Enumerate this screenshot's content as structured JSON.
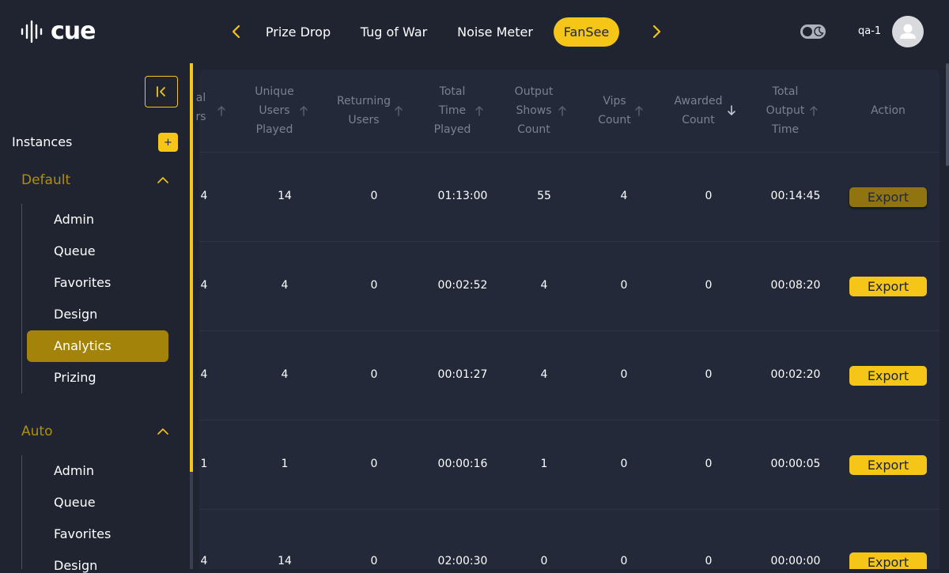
{
  "brand": {
    "logo_text": "cue"
  },
  "header": {
    "game_tabs": [
      "Prize Drop",
      "Tug of War",
      "Noise Meter",
      "FanSee"
    ],
    "active_tab": "FanSee",
    "username": "qa-1"
  },
  "colors": {
    "accent": "#f5c518",
    "background": "#1f2430",
    "active_item": "#a3830a"
  },
  "sidebar": {
    "instances_label": "Instances",
    "add_label": "+",
    "groups": [
      {
        "title": "Default",
        "items": [
          "Admin",
          "Queue",
          "Favorites",
          "Design",
          "Analytics",
          "Prizing"
        ],
        "active": "Analytics"
      },
      {
        "title": "Auto",
        "items": [
          "Admin",
          "Queue",
          "Favorites",
          "Design"
        ]
      }
    ]
  },
  "table": {
    "columns": [
      {
        "label": "Total Users",
        "visible_text": [
          "al",
          "rs"
        ]
      },
      {
        "label": "Unique Users Played",
        "lines": [
          "Unique",
          "Users",
          "Played"
        ]
      },
      {
        "label": "Returning Users",
        "lines": [
          "Returning",
          "Users"
        ]
      },
      {
        "label": "Total Time Played",
        "lines": [
          "Total",
          "Time",
          "Played"
        ]
      },
      {
        "label": "Output Shows Count",
        "lines": [
          "Output",
          "Shows",
          "Count"
        ]
      },
      {
        "label": "Vips Count",
        "lines": [
          "Vips",
          "Count"
        ]
      },
      {
        "label": "Awarded Count",
        "lines": [
          "Awarded",
          "Count"
        ]
      },
      {
        "label": "Total Output Time",
        "lines": [
          "Total",
          "Output",
          "Time"
        ]
      },
      {
        "label": "Action",
        "lines": [
          "Action"
        ]
      }
    ],
    "rows": [
      {
        "total": "4",
        "unique": "14",
        "returning": "0",
        "time_played": "01:13:00",
        "output_shows": "55",
        "vips": "4",
        "awarded": "0",
        "output_time": "00:14:45",
        "action": "Export"
      },
      {
        "total": "4",
        "unique": "4",
        "returning": "0",
        "time_played": "00:02:52",
        "output_shows": "4",
        "vips": "0",
        "awarded": "0",
        "output_time": "00:08:20",
        "action": "Export"
      },
      {
        "total": "4",
        "unique": "4",
        "returning": "0",
        "time_played": "00:01:27",
        "output_shows": "4",
        "vips": "0",
        "awarded": "0",
        "output_time": "00:02:20",
        "action": "Export"
      },
      {
        "total": "1",
        "unique": "1",
        "returning": "0",
        "time_played": "00:00:16",
        "output_shows": "1",
        "vips": "0",
        "awarded": "0",
        "output_time": "00:00:05",
        "action": "Export"
      },
      {
        "total": "4",
        "unique": "14",
        "returning": "0",
        "time_played": "02:00:30",
        "output_shows": "0",
        "vips": "0",
        "awarded": "0",
        "output_time": "00:00:00",
        "action": "Export"
      }
    ]
  },
  "icons": [
    "cue-logo-icon",
    "chevron-left-icon",
    "chevron-right-icon",
    "moon-icon",
    "user-avatar-icon",
    "collapse-sidebar-icon",
    "chevron-up-icon",
    "sort-arrow-up-icon",
    "sort-arrow-down-icon"
  ]
}
